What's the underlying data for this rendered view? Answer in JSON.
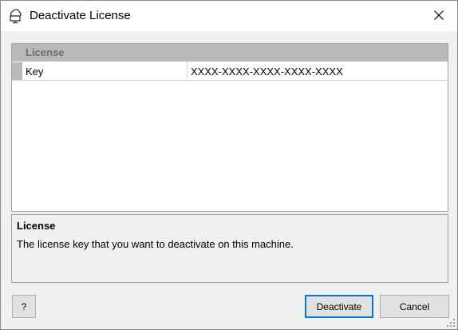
{
  "window": {
    "title": "Deactivate License",
    "icon": "cloud-monitor-icon",
    "close_icon": "close-icon"
  },
  "property_grid": {
    "category": "License",
    "rows": [
      {
        "name": "Key",
        "value": "XXXX-XXXX-XXXX-XXXX-XXXX"
      }
    ]
  },
  "description": {
    "title": "License",
    "text": "The license key that you want to deactivate on this machine."
  },
  "buttons": {
    "help": "?",
    "deactivate": "Deactivate",
    "cancel": "Cancel"
  }
}
